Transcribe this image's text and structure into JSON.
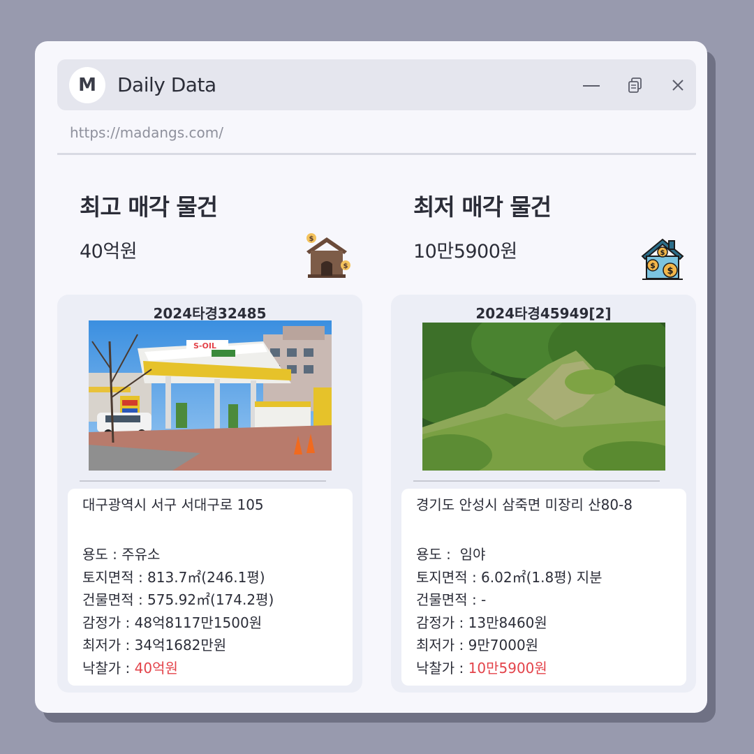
{
  "app": {
    "logo_letter": "M",
    "title": "Daily Data",
    "url": "https://madangs.com/"
  },
  "icons": {
    "minimize": "minimize-icon",
    "restore": "restore-icon",
    "close": "close-icon",
    "left_header": "house-coins-icon",
    "right_header": "house-dollar-icon"
  },
  "colors": {
    "background": "#989aae",
    "window": "#f7f7fc",
    "titlebar": "#e5e6ee",
    "card": "#eceef6",
    "highlight": "#e3434a"
  },
  "highest": {
    "heading": "최고 매각 물건",
    "price": "40억원",
    "case_no": "2024타경32485",
    "address": "대구광역시 서구 서대구로 105",
    "usage": "용도 : 주유소",
    "land_area": "토지면적 : 813.7㎡(246.1평)",
    "building_area": "건물면적 : 575.92㎡(174.2평)",
    "appraisal": "감정가 : 48억8117만1500원",
    "minimum": "최저가 : 34억1682만원",
    "winning_label": "낙찰가 : ",
    "winning_value": "40억원"
  },
  "lowest": {
    "heading": "최저 매각 물건",
    "price": "10만5900원",
    "case_no": "2024타경45949[2]",
    "address": "경기도 안성시 삼죽면 미장리 산80-8",
    "usage": "용도 :  임야",
    "land_area": "토지면적 : 6.02㎡(1.8평) 지분",
    "building_area": "건물면적 : -",
    "appraisal": "감정가 : 13만8460원",
    "minimum": "최저가 : 9만7000원",
    "winning_label": "낙찰가 : ",
    "winning_value": "10만5900원"
  }
}
